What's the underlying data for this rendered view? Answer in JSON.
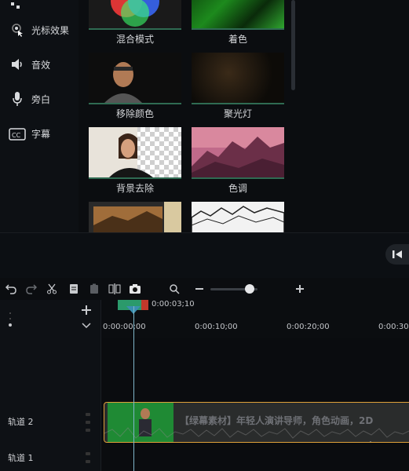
{
  "sidebar": {
    "items": [
      {
        "label": "光标效果",
        "icon": "cursor-effect-icon"
      },
      {
        "label": "音效",
        "icon": "speaker-icon"
      },
      {
        "label": "旁白",
        "icon": "microphone-icon"
      },
      {
        "label": "字幕",
        "icon": "cc-icon"
      }
    ]
  },
  "effects": {
    "tiles": [
      {
        "label": "混合模式"
      },
      {
        "label": "着色"
      },
      {
        "label": "移除颜色"
      },
      {
        "label": "聚光灯"
      },
      {
        "label": "背景去除"
      },
      {
        "label": "色调"
      },
      {
        "label": ""
      },
      {
        "label": ""
      }
    ]
  },
  "timeline": {
    "playhead_time": "0:00:03;10",
    "ruler_ticks": [
      "0:00:00;00",
      "0:00:10;00",
      "0:00:20;00",
      "0:00:30"
    ],
    "tracks": [
      {
        "label": "轨道 2"
      },
      {
        "label": "轨道 1"
      }
    ],
    "clip_title": "【绿幕素材】年轻人演讲导师，角色动画，2D"
  },
  "colors": {
    "accent_green": "#2b9a6b",
    "clip_border": "#e0a13a",
    "playhead": "#7fb6c9"
  }
}
